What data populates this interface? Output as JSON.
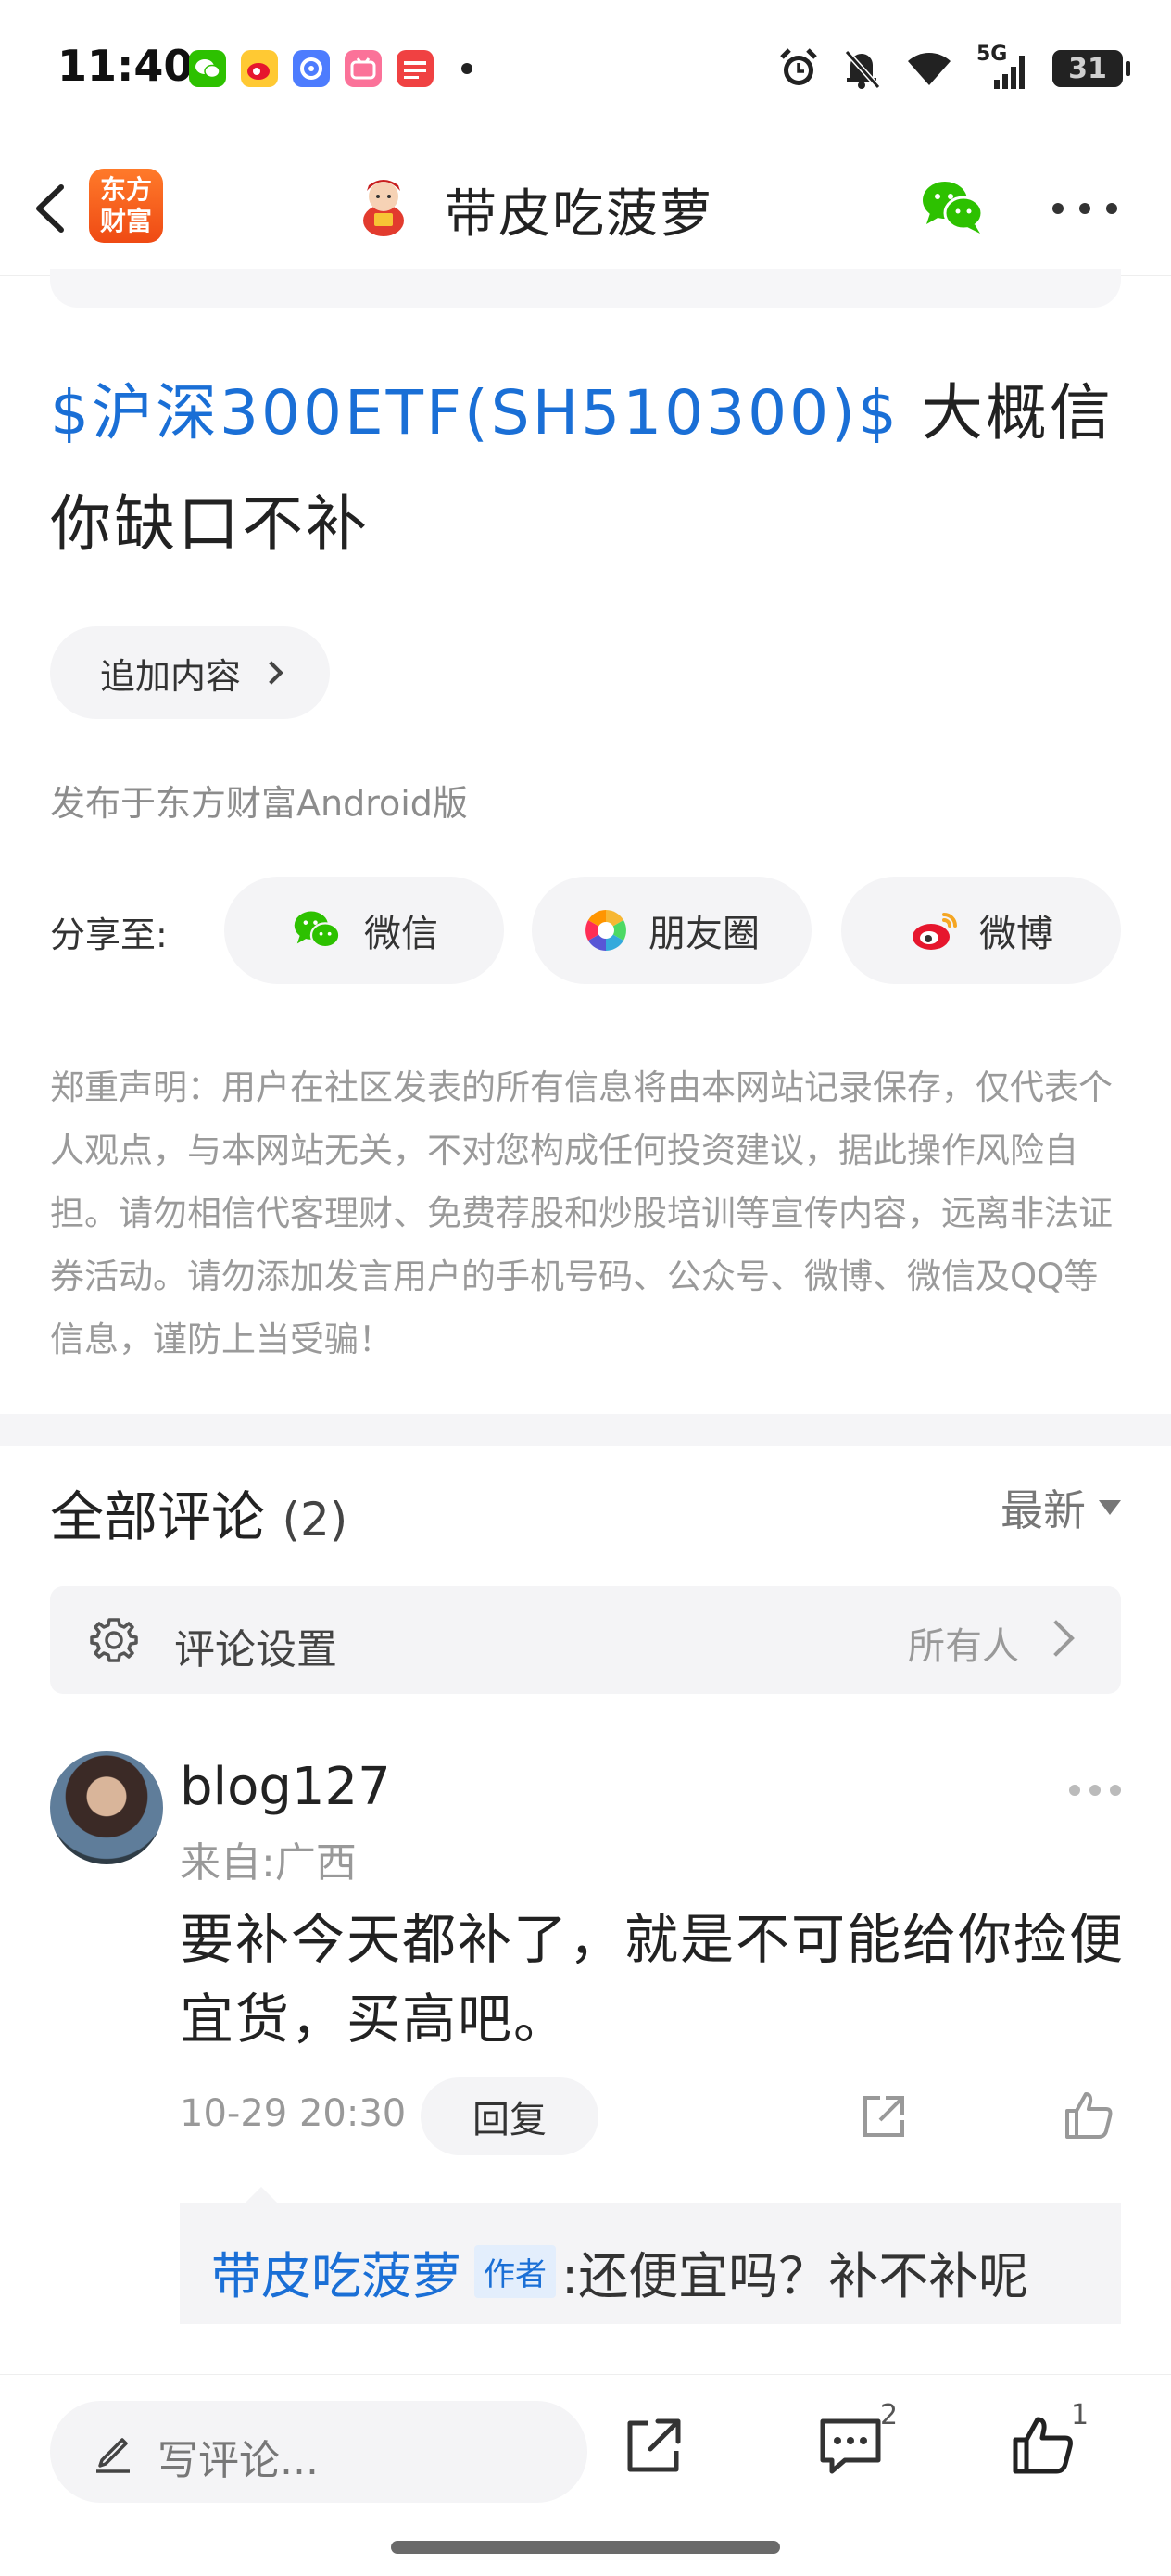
{
  "status_bar": {
    "time": "11:40",
    "network": "5G",
    "battery": "31"
  },
  "nav": {
    "logo_text_line1": "东方",
    "logo_text_line2": "财富",
    "title": "带皮吃菠萝"
  },
  "post": {
    "stock_tag": "$沪深300ETF(SH510300)$",
    "text": "大概信你缺口不补",
    "add_content_label": "追加内容",
    "published_from": "发布于东方财富Android版"
  },
  "share": {
    "label": "分享至:",
    "wechat": "微信",
    "moments": "朋友圈",
    "weibo": "微博"
  },
  "disclaimer": "郑重声明：用户在社区发表的所有信息将由本网站记录保存，仅代表个人观点，与本网站无关，不对您构成任何投资建议，据此操作风险自担。请勿相信代客理财、免费荐股和炒股培训等宣传内容，远离非法证券活动。请勿添加发言用户的手机号码、公众号、微博、微信及QQ等信息，谨防上当受骗！",
  "comments": {
    "title": "全部评论",
    "count": "(2)",
    "sort": "最新",
    "settings_label": "评论设置",
    "settings_value": "所有人",
    "items": [
      {
        "user": "blog127",
        "location": "来自:广西",
        "text": "要补今天都补了，就是不可能给你捡便宜货，买高吧。",
        "time": "10-29 20:30",
        "reply_label": "回复",
        "reply": {
          "author": "带皮吃菠萝",
          "tag": "作者",
          "text": ":还便宜吗？补不补呢"
        }
      }
    ]
  },
  "bottom_bar": {
    "write_placeholder": "写评论...",
    "comment_count": "2",
    "like_count": "1"
  },
  "colors": {
    "link_blue": "#1a6fd6",
    "brand_orange": "#ef4a14",
    "wechat_green": "#2dc100"
  }
}
